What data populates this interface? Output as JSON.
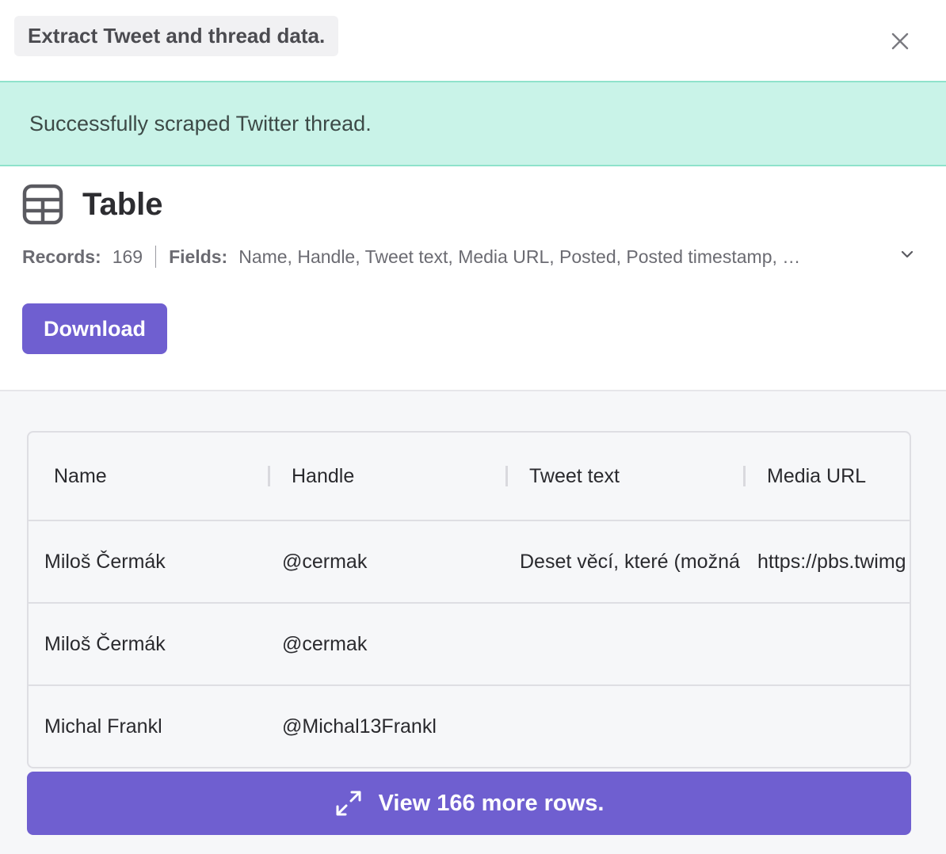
{
  "header": {
    "task_label": "Extract Tweet and thread data.",
    "close_icon": "close-icon"
  },
  "banner": {
    "message": "Successfully scraped Twitter thread."
  },
  "summary": {
    "title": "Table",
    "records_label": "Records:",
    "records_value": "169",
    "fields_label": "Fields:",
    "fields_value": "Name, Handle, Tweet text, Media URL, Posted, Posted timestamp, …",
    "download_label": "Download"
  },
  "table": {
    "columns": [
      "Name",
      "Handle",
      "Tweet text",
      "Media URL"
    ],
    "rows": [
      {
        "name": "Miloš Čermák",
        "handle": "@cermak",
        "tweet_text": "Deset věcí, které (možná",
        "media_url": "https://pbs.twimg"
      },
      {
        "name": "Miloš Čermák",
        "handle": "@cermak",
        "tweet_text": "",
        "media_url": ""
      },
      {
        "name": "Michal Frankl",
        "handle": "@Michal13Frankl",
        "tweet_text": "",
        "media_url": ""
      }
    ],
    "more_rows_label": "View 166 more rows."
  },
  "colors": {
    "accent": "#6f5fd0",
    "success_bg": "#c9f3e8",
    "success_border": "#8fe2cb"
  }
}
